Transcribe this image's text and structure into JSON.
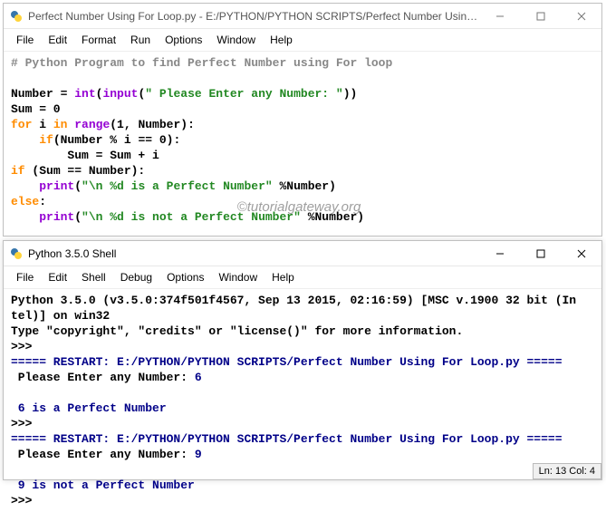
{
  "editor": {
    "title": "Perfect Number Using For Loop.py - E:/PYTHON/PYTHON SCRIPTS/Perfect Number Using F...",
    "menu": [
      "File",
      "Edit",
      "Format",
      "Run",
      "Options",
      "Window",
      "Help"
    ],
    "lines": [
      {
        "t": "comment",
        "text": "# Python Program to find Perfect Number using For loop"
      },
      {
        "t": "blank",
        "text": ""
      },
      {
        "t": "assign",
        "pre": "Number = ",
        "fn": "int",
        "paren_o": "(",
        "fn2": "input",
        "paren_o2": "(",
        "str": "\" Please Enter any Number: \"",
        "paren_c": "))"
      },
      {
        "t": "plain",
        "text": "Sum = 0"
      },
      {
        "t": "for",
        "kw1": "for",
        "mid1": " i ",
        "kw2": "in",
        "mid2": " ",
        "fn": "range",
        "args": "(1, Number):"
      },
      {
        "t": "if",
        "indent": "    ",
        "kw": "if",
        "rest": "(Number % i == 0):"
      },
      {
        "t": "plain",
        "text": "        Sum = Sum + i"
      },
      {
        "t": "if2",
        "kw": "if",
        "rest": " (Sum == Number):"
      },
      {
        "t": "print",
        "indent": "    ",
        "fn": "print",
        "paren_o": "(",
        "str": "\"\\n %d is a Perfect Number\"",
        "rest": " %Number)"
      },
      {
        "t": "else",
        "kw": "else",
        "rest": ":"
      },
      {
        "t": "print",
        "indent": "    ",
        "fn": "print",
        "paren_o": "(",
        "str": "\"\\n %d is not a Perfect Number\"",
        "rest": " %Number)"
      }
    ]
  },
  "shell": {
    "title": "Python 3.5.0 Shell",
    "menu": [
      "File",
      "Edit",
      "Shell",
      "Debug",
      "Options",
      "Window",
      "Help"
    ],
    "banner1": "Python 3.5.0 (v3.5.0:374f501f4567, Sep 13 2015, 02:16:59) [MSC v.1900 32 bit (In",
    "banner2": "tel)] on win32",
    "banner3": "Type \"copyright\", \"credits\" or \"license()\" for more information.",
    "prompt": ">>>",
    "restart": "===== RESTART: E:/PYTHON/PYTHON SCRIPTS/Perfect Number Using For Loop.py =====",
    "input1_label": " Please Enter any Number: ",
    "input1_val": "6",
    "output1": " 6 is a Perfect Number",
    "input2_label": " Please Enter any Number: ",
    "input2_val": "9",
    "output2": " 9 is not a Perfect Number",
    "status": "Ln: 13 Col: 4"
  },
  "watermark": "©tutorialgateway.org"
}
